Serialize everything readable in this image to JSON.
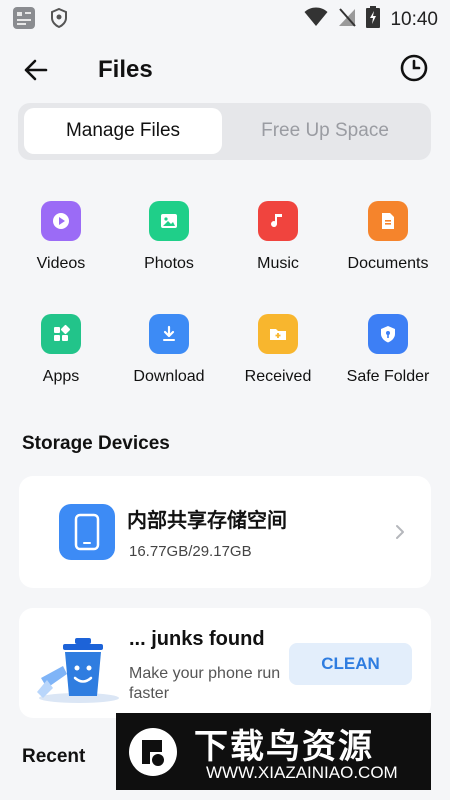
{
  "status_bar": {
    "time": "10:40",
    "icons": [
      "sim-icon",
      "shield-icon",
      "wifi-icon",
      "no-signal-icon",
      "battery-charging-icon"
    ]
  },
  "header": {
    "title": "Files",
    "back_icon": "arrow-left-icon",
    "history_icon": "clock-icon"
  },
  "tabs": [
    {
      "label": "Manage Files",
      "active": true
    },
    {
      "label": "Free Up Space",
      "active": false
    }
  ],
  "categories": [
    {
      "label": "Videos",
      "icon": "play-icon",
      "color": "#9b6bf6"
    },
    {
      "label": "Photos",
      "icon": "image-icon",
      "color": "#1fcf89"
    },
    {
      "label": "Music",
      "icon": "music-note-icon",
      "color": "#f0443e"
    },
    {
      "label": "Documents",
      "icon": "document-icon",
      "color": "#f5842c"
    },
    {
      "label": "Apps",
      "icon": "apps-grid-icon",
      "color": "#22c48a"
    },
    {
      "label": "Download",
      "icon": "download-icon",
      "color": "#3d8bf5"
    },
    {
      "label": "Received",
      "icon": "folder-icon",
      "color": "#f8b62e"
    },
    {
      "label": "Safe Folder",
      "icon": "shield-lock-icon",
      "color": "#3d7ff5"
    }
  ],
  "storage": {
    "section_title": "Storage Devices",
    "device_name": "内部共享存储空间",
    "usage": "16.77GB/29.17GB",
    "used_fraction": 0.575,
    "icon": "phone-icon"
  },
  "junk": {
    "title": "... junks found",
    "subtitle": "Make your phone run faster",
    "button": "CLEAN",
    "icon": "trash-bin-icon"
  },
  "recent": {
    "section_title": "Recent"
  },
  "watermark": {
    "text": "下载鸟资源",
    "url": "WWW.XIAZAINIAO.COM"
  },
  "colors": {
    "accent": "#3d8bf5",
    "background": "#f5f6f8",
    "clean_button_bg": "#e3eefb"
  }
}
